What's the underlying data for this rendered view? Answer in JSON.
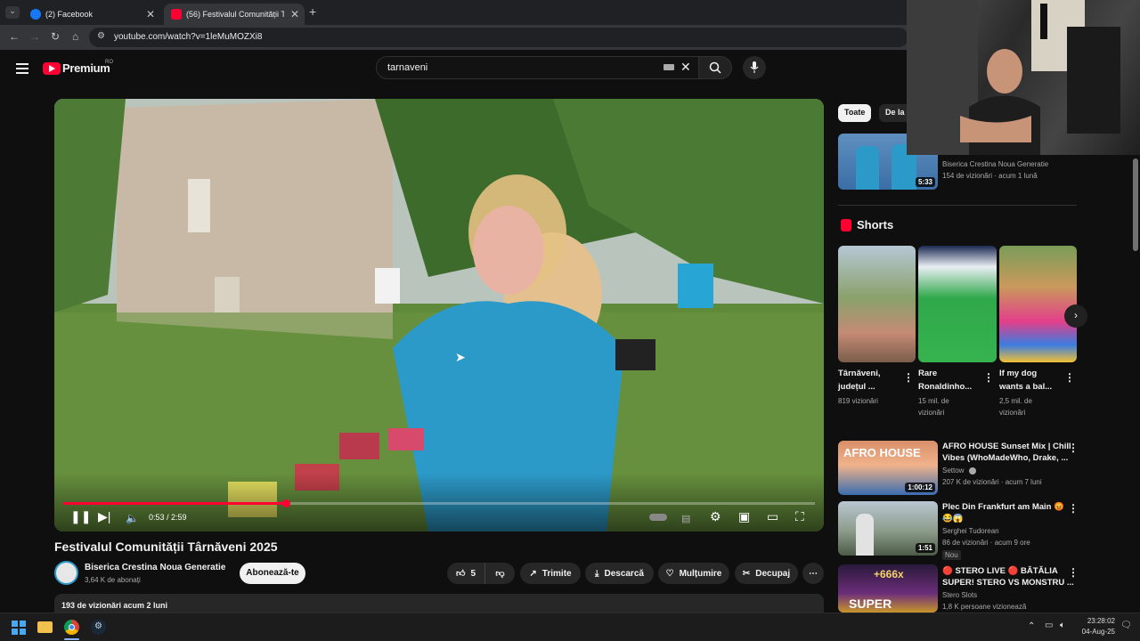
{
  "browser": {
    "tabs": [
      {
        "label": "(2) Facebook"
      },
      {
        "label": "(56) Festivalul Comunității T"
      }
    ],
    "url": "youtube.com/watch?v=1leMuMOZXi8"
  },
  "masthead": {
    "logo_text": "Premium",
    "region": "RO",
    "search_value": "tarnaveni"
  },
  "player": {
    "time": "0:53 / 2:59",
    "progress": 0.296
  },
  "video": {
    "title": "Festivalul Comunității Târnăveni 2025",
    "channel": "Biserica Crestina Noua Generatie",
    "subscribers": "3,64 K de abonați",
    "subscribe_label": "Abonează-te",
    "likes": "5",
    "share_label": "Trimite",
    "download_label": "Descarcă",
    "thanks_label": "Mulțumire",
    "clip_label": "Decupaj",
    "views_date": "193 de vizionări  acum 2 luni"
  },
  "sidebar": {
    "chips": [
      "Toate",
      "De la"
    ],
    "top_video": {
      "channel": "Biserica Crestina Noua Generatie",
      "meta": "154 de vizionări · acum 1 lună",
      "duration": "5:33"
    },
    "shorts_heading": "Shorts",
    "shorts": [
      {
        "title_line1": "Târnăveni,",
        "title_line2": "județul ...",
        "views_line1": "819 vizionări",
        "views_line2": ""
      },
      {
        "title_line1": "Rare",
        "title_line2": "Ronaldinho...",
        "views_line1": "15 mil. de",
        "views_line2": "vizionări"
      },
      {
        "title_line1": "If my dog",
        "title_line2": "wants a bal...",
        "views_line1": "2,5 mil. de",
        "views_line2": "vizionări"
      }
    ],
    "videos": [
      {
        "title_line1": "AFRO HOUSE Sunset Mix | Chill",
        "title_line2": "Vibes (WhoMadeWho, Drake, ...",
        "channel": "Settow",
        "meta": "207 K de vizionări · acum 7 luni",
        "duration": "1:00:12",
        "badge": ""
      },
      {
        "title_line1": "Plec Din Frankfurt am Main 😡",
        "title_line2": "😂😱",
        "channel": "Serghei Tudorean",
        "meta": "86 de vizionări · acum 9 ore",
        "duration": "1:51",
        "badge": "Nou"
      },
      {
        "title_line1": "🔴 STERO LIVE 🔴 BĂTĂLIA",
        "title_line2": "SUPER! STERO VS MONSTRU ...",
        "channel": "Stero Slots",
        "meta": "1,8 K persoane vizionează",
        "duration": "",
        "badge": ""
      }
    ],
    "thumb_text": {
      "afro": "AFRO HOUSE",
      "stero": "SUPER",
      "stero_mult": "+666x"
    }
  },
  "taskbar": {
    "time": "23:28:02",
    "date": "04-Aug-25"
  }
}
